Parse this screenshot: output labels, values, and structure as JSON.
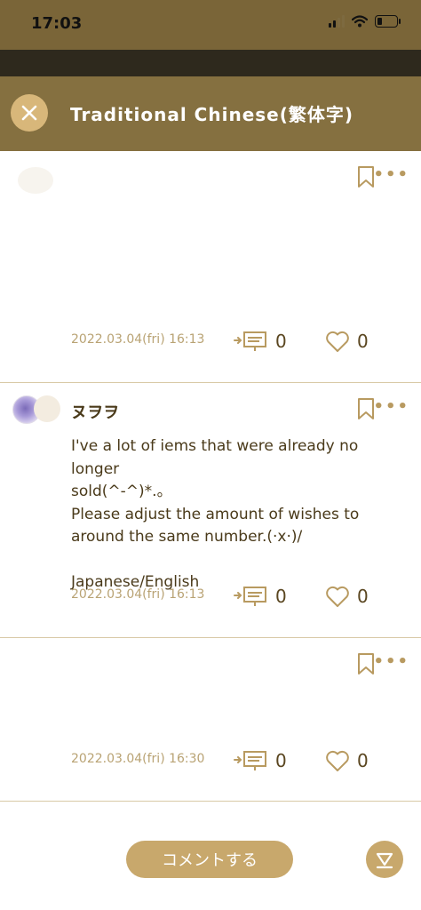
{
  "status": {
    "time": "17:03"
  },
  "header": {
    "title": "Traditional Chinese(繁体字)"
  },
  "posts": [
    {
      "time": "2022.03.04(fri) 16:13",
      "reply_count": "0",
      "like_count": "0"
    },
    {
      "username": "ヌヲヲ",
      "lines": [
        "I've a lot of iems that were already no longer",
        "sold(^-^)*.。",
        "Please adjust the amount of wishes to",
        "around the same number.(·x·)/",
        "",
        "Japanese/English"
      ],
      "time": "2022.03.04(fri) 16:13",
      "reply_count": "0",
      "like_count": "0"
    },
    {
      "time": "2022.03.04(fri) 16:30",
      "reply_count": "0",
      "like_count": "0"
    }
  ],
  "footer": {
    "comment_label": "コメントする"
  }
}
